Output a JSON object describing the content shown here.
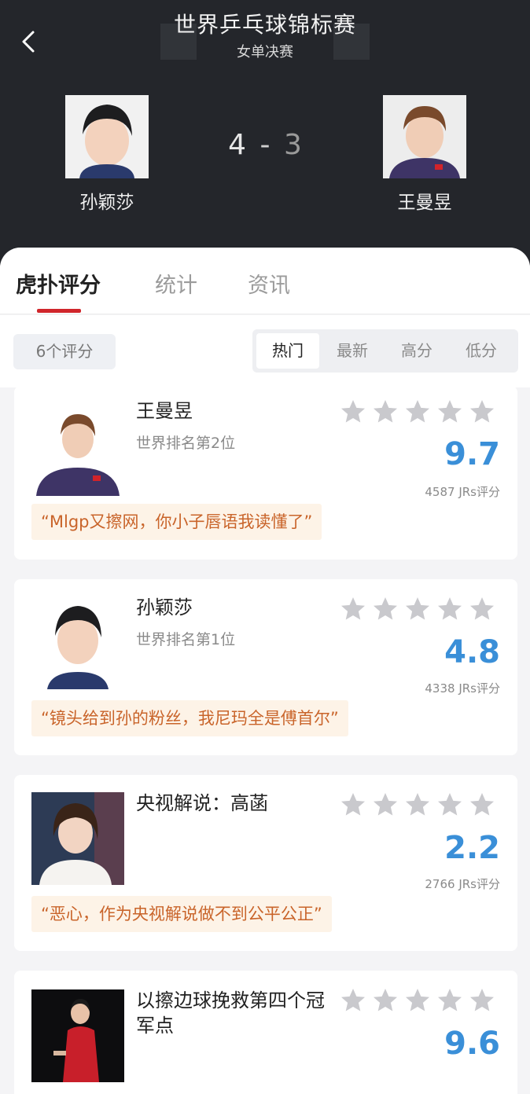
{
  "header": {
    "title": "世界乒乓球锦标赛",
    "subtitle": "女单决赛",
    "left_player": "孙颖莎",
    "right_player": "王曼昱",
    "score_left": "4",
    "score_sep": "-",
    "score_right": "3"
  },
  "tabs": [
    "虎扑评分",
    "统计",
    "资讯"
  ],
  "filters": {
    "count": "6个评分",
    "options": [
      "热门",
      "最新",
      "高分",
      "低分"
    ],
    "selected": "热门"
  },
  "cards": [
    {
      "name": "王曼昱",
      "rank": "世界排名第2位",
      "rating": "9.7",
      "votes": "4587 JRs评分",
      "quote": "“Mlgp又擦网，你小子唇语我读懂了”",
      "avatar": "player-photo"
    },
    {
      "name": "孙颖莎",
      "rank": "世界排名第1位",
      "rating": "4.8",
      "votes": "4338 JRs评分",
      "quote": "“镜头给到孙的粉丝，我尼玛全是傅首尔”",
      "avatar": "player-photo"
    },
    {
      "name": "央视解说：高菡",
      "rank": "",
      "rating": "2.2",
      "votes": "2766 JRs评分",
      "quote": "“恶心，作为央视解说做不到公平公正”",
      "avatar": "commentator-photo"
    },
    {
      "name": "以擦边球挽救第四个冠军点",
      "rank": "",
      "rating": "9.6",
      "votes": "",
      "quote": "",
      "avatar": "match-photo"
    }
  ],
  "colors": {
    "header_bg": "#24262b",
    "accent_red": "#d0262b",
    "rating_blue": "#3a8fd8",
    "quote_text": "#c9642a",
    "quote_bg": "#fdf3e7",
    "star_gray": "#c9c9cd"
  }
}
